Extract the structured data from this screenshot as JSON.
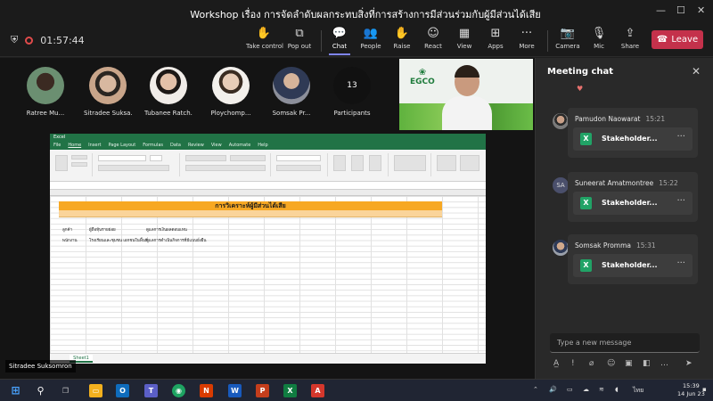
{
  "window": {
    "title": "Workshop เรื่อง การจัดลำดับผลกระทบสิ่งที่การสร้างการมีส่วนร่วมกับผู้มีส่วนได้เสีย",
    "controls": {
      "minimize": "—",
      "maximize": "☐",
      "close": "✕"
    }
  },
  "toolbar": {
    "timer": "01:57:44",
    "buttons": [
      {
        "label": "Take control",
        "icon": "✋"
      },
      {
        "label": "Pop out",
        "icon": "⧉"
      },
      {
        "label": "Chat",
        "icon": "💬"
      },
      {
        "label": "People",
        "icon": "👥"
      },
      {
        "label": "Raise",
        "icon": "✋"
      },
      {
        "label": "React",
        "icon": "☺"
      },
      {
        "label": "View",
        "icon": "▦"
      },
      {
        "label": "Apps",
        "icon": "⊞"
      },
      {
        "label": "More",
        "icon": "···"
      },
      {
        "label": "Camera",
        "icon": "📷"
      },
      {
        "label": "Mic",
        "icon": "🎙"
      },
      {
        "label": "Share",
        "icon": "⇪"
      }
    ],
    "leave_label": "Leave",
    "leave_color": "#c4314b"
  },
  "participants": [
    {
      "name": "Ratree Mu...",
      "color": "#6b8f71"
    },
    {
      "name": "Sitradee Suksa...",
      "color": "#c9a58a"
    },
    {
      "name": "Tubanee Ratch...",
      "color": "#d9b3a0"
    },
    {
      "name": "Ploychomp...",
      "color": "#e0d0c4"
    },
    {
      "name": "Somsak Pr...",
      "color": "#8c8f9a"
    }
  ],
  "participants_count": "13",
  "participants_label": "Participants",
  "video_logo": "EGCO",
  "excel": {
    "title_bar": "Excel",
    "tabs": [
      "File",
      "Home",
      "Insert",
      "Page Layout",
      "Formulas",
      "Data",
      "Review",
      "View",
      "Automate",
      "Help"
    ],
    "banner_title": "การวิเคราะห์ผู้มีส่วนได้เสีย",
    "sheet_tab": "Sheet1",
    "rows": [
      {
        "c1": "ลูกค้า",
        "c2": "ผู้ถือหุ้นรายย่อย",
        "c3": "ดูแลการเงินผลตอบแทน"
      },
      {
        "c1": "พนักงาน",
        "c2": "โรงเรียนและชุมชน เอกชนในพื้นที่",
        "c3": "ดูแลการดำเนินกิจการที่มีแบบยั่งยืน"
      }
    ]
  },
  "presenter_name": "Sitradee Suksomron",
  "chat": {
    "title": "Meeting chat",
    "messages": [
      {
        "sender": "Pamudon Naowarat",
        "time": "15:21",
        "file": "Stakeholder...",
        "avatar": "photo"
      },
      {
        "sender": "Suneerat Amatmontree",
        "time": "15:22",
        "file": "Stakeholder...",
        "avatar": "SA"
      },
      {
        "sender": "Somsak Promma",
        "time": "15:31",
        "file": "Stakeholder...",
        "avatar": "photo"
      }
    ],
    "input_placeholder": "Type a new message"
  },
  "taskbar": {
    "language": "ไทย",
    "time": "15:39",
    "date": "14 Jun 23"
  }
}
